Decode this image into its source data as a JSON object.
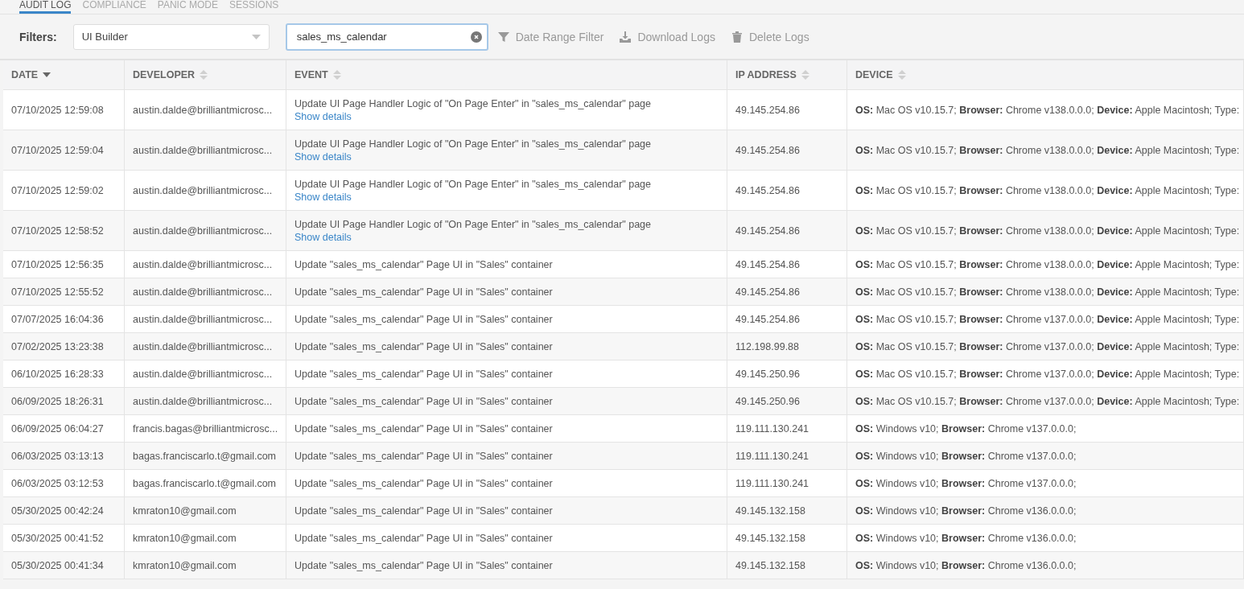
{
  "tabs": [
    {
      "label": "AUDIT LOG",
      "selected": true
    },
    {
      "label": "COMPLIANCE",
      "selected": false
    },
    {
      "label": "PANIC MODE",
      "selected": false
    },
    {
      "label": "SESSIONS",
      "selected": false
    }
  ],
  "filters": {
    "label": "Filters:",
    "module_select": {
      "value": "UI Builder"
    },
    "search": {
      "value": "sales_ms_calendar"
    },
    "actions": [
      {
        "kind": "filter",
        "label": "Date Range Filter"
      },
      {
        "kind": "download",
        "label": "Download Logs"
      },
      {
        "kind": "delete",
        "label": "Delete Logs"
      }
    ]
  },
  "table": {
    "columns": [
      {
        "label": "DATE",
        "sorted": true
      },
      {
        "label": "DEVELOPER",
        "sorted": false
      },
      {
        "label": "EVENT",
        "sorted": false
      },
      {
        "label": "IP ADDRESS",
        "sorted": false
      },
      {
        "label": "DEVICE",
        "sorted": false
      }
    ],
    "rows": [
      {
        "date": "07/10/2025 12:59:08",
        "developer": "austin.dalde@brilliantmicrosc...",
        "event": "Update UI Page Handler Logic of \"On Page Enter\" in \"sales_ms_calendar\" page",
        "details_link": "Show details",
        "ip": "49.145.254.86",
        "device": "**OS:** Mac OS v10.15.7; **Browser:** Chrome v138.0.0.0; **Device:** Apple Macintosh; Type:"
      },
      {
        "date": "07/10/2025 12:59:04",
        "developer": "austin.dalde@brilliantmicrosc...",
        "event": "Update UI Page Handler Logic of \"On Page Enter\" in \"sales_ms_calendar\" page",
        "details_link": "Show details",
        "ip": "49.145.254.86",
        "device": "**OS:** Mac OS v10.15.7; **Browser:** Chrome v138.0.0.0; **Device:** Apple Macintosh; Type:"
      },
      {
        "date": "07/10/2025 12:59:02",
        "developer": "austin.dalde@brilliantmicrosc...",
        "event": "Update UI Page Handler Logic of \"On Page Enter\" in \"sales_ms_calendar\" page",
        "details_link": "Show details",
        "ip": "49.145.254.86",
        "device": "**OS:** Mac OS v10.15.7; **Browser:** Chrome v138.0.0.0; **Device:** Apple Macintosh; Type:"
      },
      {
        "date": "07/10/2025 12:58:52",
        "developer": "austin.dalde@brilliantmicrosc...",
        "event": "Update UI Page Handler Logic of \"On Page Enter\" in \"sales_ms_calendar\" page",
        "details_link": "Show details",
        "ip": "49.145.254.86",
        "device": "**OS:** Mac OS v10.15.7; **Browser:** Chrome v138.0.0.0; **Device:** Apple Macintosh; Type:"
      },
      {
        "date": "07/10/2025 12:56:35",
        "developer": "austin.dalde@brilliantmicrosc...",
        "event": "Update \"sales_ms_calendar\" Page UI in \"Sales\" container",
        "ip": "49.145.254.86",
        "device": "**OS:** Mac OS v10.15.7; **Browser:** Chrome v138.0.0.0; **Device:** Apple Macintosh; Type:"
      },
      {
        "date": "07/10/2025 12:55:52",
        "developer": "austin.dalde@brilliantmicrosc...",
        "event": "Update \"sales_ms_calendar\" Page UI in \"Sales\" container",
        "ip": "49.145.254.86",
        "device": "**OS:** Mac OS v10.15.7; **Browser:** Chrome v138.0.0.0; **Device:** Apple Macintosh; Type:"
      },
      {
        "date": "07/07/2025 16:04:36",
        "developer": "austin.dalde@brilliantmicrosc...",
        "event": "Update \"sales_ms_calendar\" Page UI in \"Sales\" container",
        "ip": "49.145.254.86",
        "device": "**OS:** Mac OS v10.15.7; **Browser:** Chrome v137.0.0.0; **Device:** Apple Macintosh; Type:"
      },
      {
        "date": "07/02/2025 13:23:38",
        "developer": "austin.dalde@brilliantmicrosc...",
        "event": "Update \"sales_ms_calendar\" Page UI in \"Sales\" container",
        "ip": "112.198.99.88",
        "device": "**OS:** Mac OS v10.15.7; **Browser:** Chrome v137.0.0.0; **Device:** Apple Macintosh; Type:"
      },
      {
        "date": "06/10/2025 16:28:33",
        "developer": "austin.dalde@brilliantmicrosc...",
        "event": "Update \"sales_ms_calendar\" Page UI in \"Sales\" container",
        "ip": "49.145.250.96",
        "device": "**OS:** Mac OS v10.15.7; **Browser:** Chrome v137.0.0.0; **Device:** Apple Macintosh; Type:"
      },
      {
        "date": "06/09/2025 18:26:31",
        "developer": "austin.dalde@brilliantmicrosc...",
        "event": "Update \"sales_ms_calendar\" Page UI in \"Sales\" container",
        "ip": "49.145.250.96",
        "device": "**OS:** Mac OS v10.15.7; **Browser:** Chrome v137.0.0.0; **Device:** Apple Macintosh; Type:"
      },
      {
        "date": "06/09/2025 06:04:27",
        "developer": "francis.bagas@brilliantmicrosc...",
        "event": "Update \"sales_ms_calendar\" Page UI in \"Sales\" container",
        "ip": "119.111.130.241",
        "device": "**OS:** Windows v10; **Browser:** Chrome v137.0.0.0;"
      },
      {
        "date": "06/03/2025 03:13:13",
        "developer": "bagas.franciscarlo.t@gmail.com",
        "event": "Update \"sales_ms_calendar\" Page UI in \"Sales\" container",
        "ip": "119.111.130.241",
        "device": "**OS:** Windows v10; **Browser:** Chrome v137.0.0.0;"
      },
      {
        "date": "06/03/2025 03:12:53",
        "developer": "bagas.franciscarlo.t@gmail.com",
        "event": "Update \"sales_ms_calendar\" Page UI in \"Sales\" container",
        "ip": "119.111.130.241",
        "device": "**OS:** Windows v10; **Browser:** Chrome v137.0.0.0;"
      },
      {
        "date": "05/30/2025 00:42:24",
        "developer": "kmraton10@gmail.com",
        "event": "Update \"sales_ms_calendar\" Page UI in \"Sales\" container",
        "ip": "49.145.132.158",
        "device": "**OS:** Windows v10; **Browser:** Chrome v136.0.0.0;"
      },
      {
        "date": "05/30/2025 00:41:52",
        "developer": "kmraton10@gmail.com",
        "event": "Update \"sales_ms_calendar\" Page UI in \"Sales\" container",
        "ip": "49.145.132.158",
        "device": "**OS:** Windows v10; **Browser:** Chrome v136.0.0.0;"
      },
      {
        "date": "05/30/2025 00:41:34",
        "developer": "kmraton10@gmail.com",
        "event": "Update \"sales_ms_calendar\" Page UI in \"Sales\" container",
        "ip": "49.145.132.158",
        "device": "**OS:** Windows v10; **Browser:** Chrome v136.0.0.0;"
      }
    ]
  }
}
